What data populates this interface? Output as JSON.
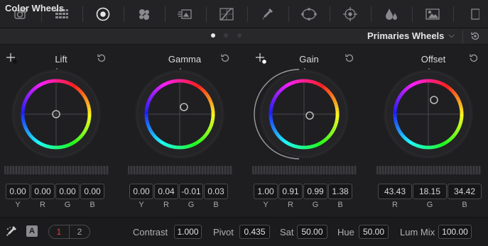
{
  "toolbar": {
    "tools": [
      {
        "name": "camera-raw-icon",
        "active": false
      },
      {
        "name": "color-match-icon",
        "active": false
      },
      {
        "name": "color-wheels-icon",
        "active": true
      },
      {
        "name": "rgb-mixer-icon",
        "active": false
      },
      {
        "name": "motion-effects-icon",
        "active": false
      },
      {
        "name": "curves-icon",
        "active": false
      },
      {
        "name": "qualifier-icon",
        "active": false
      },
      {
        "name": "window-icon",
        "active": false
      },
      {
        "name": "tracker-icon",
        "active": false
      },
      {
        "name": "blur-icon",
        "active": false
      },
      {
        "name": "key-icon",
        "active": false
      }
    ]
  },
  "header": {
    "title": "Color Wheels",
    "page_dots": 3,
    "active_dot": 0,
    "mode": "Primaries Wheels"
  },
  "wheels": [
    {
      "label": "Lift",
      "values": [
        "0.00",
        "0.00",
        "0.00",
        "0.00"
      ],
      "channels": [
        "Y",
        "R",
        "G",
        "B"
      ],
      "picker": true
    },
    {
      "label": "Gamma",
      "values": [
        "0.00",
        "0.04",
        "-0.01",
        "0.03"
      ],
      "channels": [
        "Y",
        "R",
        "G",
        "B"
      ],
      "picker": false
    },
    {
      "label": "Gain",
      "values": [
        "1.00",
        "0.91",
        "0.99",
        "1.38"
      ],
      "channels": [
        "Y",
        "R",
        "G",
        "B"
      ],
      "picker": true
    },
    {
      "label": "Offset",
      "values": [
        "43.43",
        "18.15",
        "34.42"
      ],
      "channels": [
        "R",
        "G",
        "B"
      ],
      "picker": false
    }
  ],
  "bottom": {
    "auto_label": "A",
    "pages": [
      "1",
      "2"
    ],
    "active_page": "1",
    "contrast_label": "Contrast",
    "contrast": "1.000",
    "pivot_label": "Pivot",
    "pivot": "0.435",
    "sat_label": "Sat",
    "sat": "50.00",
    "hue_label": "Hue",
    "hue": "50.00",
    "lummix_label": "Lum Mix",
    "lummix": "100.00"
  },
  "colors": {
    "accent_red": "#e0403a",
    "panel_bg": "#1e1e20"
  }
}
